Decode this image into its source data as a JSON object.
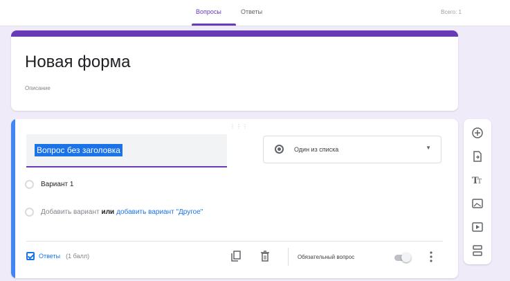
{
  "header": {
    "tabs": [
      {
        "label": "Вопросы",
        "active": true
      },
      {
        "label": "Ответы",
        "active": false
      }
    ],
    "right_text": "Всего: 1"
  },
  "form": {
    "title": "Новая форма",
    "description_placeholder": "Описание"
  },
  "question": {
    "title": "Вопрос без заголовка",
    "type": "Один из списка",
    "options": [
      "Вариант 1"
    ],
    "add_option": "Добавить вариант",
    "or_text": "или",
    "add_other": "добавить вариант \"Другое\"",
    "footer": {
      "answers_label": "Ответы",
      "points": "(1 балл)",
      "required_label": "Обязательный вопрос",
      "required": false
    }
  },
  "toolbar_icons": [
    "add-question-icon",
    "import-questions-icon",
    "add-title-icon",
    "add-image-icon",
    "add-video-icon",
    "add-section-icon"
  ],
  "colors": {
    "accent": "#673ab7",
    "background": "#f0ebf8",
    "active_bar": "#4285f4",
    "link": "#1a73e8"
  }
}
